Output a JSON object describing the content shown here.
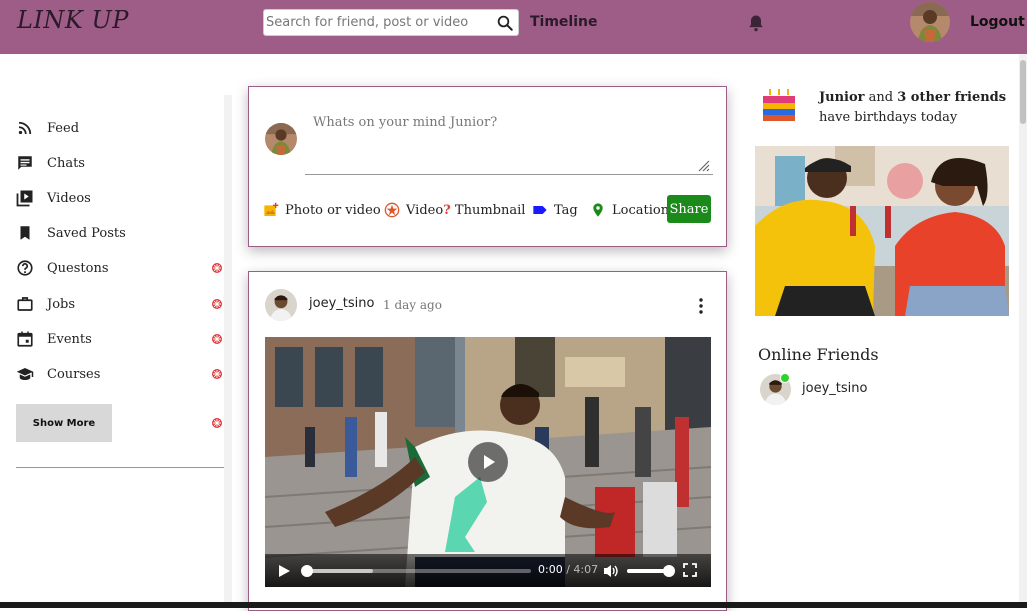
{
  "brand": {
    "logo": "LINK UP"
  },
  "header": {
    "search_placeholder": "Search for friend, post or video",
    "timeline_label": "Timeline",
    "logout_label": "Logout"
  },
  "sidebar": {
    "items": [
      {
        "label": "Feed",
        "icon": "rss-icon",
        "badge": false
      },
      {
        "label": "Chats",
        "icon": "chat-icon",
        "badge": false
      },
      {
        "label": "Videos",
        "icon": "video-library-icon",
        "badge": false
      },
      {
        "label": "Saved Posts",
        "icon": "bookmark-icon",
        "badge": false
      },
      {
        "label": "Questons",
        "icon": "help-circle-icon",
        "badge": true
      },
      {
        "label": "Jobs",
        "icon": "briefcase-icon",
        "badge": true
      },
      {
        "label": "Events",
        "icon": "calendar-icon",
        "badge": true
      },
      {
        "label": "Courses",
        "icon": "graduation-cap-icon",
        "badge": true
      }
    ],
    "show_more_label": "Show More"
  },
  "composer": {
    "placeholder": "Whats on your mind Junior?",
    "options": {
      "photo": "Photo or video",
      "video_thumb": "Video",
      "video_thumb_mark": "?",
      "video_thumb_rest": " Thumbnail",
      "tag": "Tag",
      "location": "Location"
    },
    "share_label": "Share"
  },
  "post": {
    "username": "joey_tsino",
    "time": "1 day ago",
    "video": {
      "current_time": "0:00",
      "separator": " / ",
      "duration": "4:07",
      "progress": 0,
      "buffered": 0.3,
      "volume": 1
    }
  },
  "rightbar": {
    "birthday": {
      "name": "Junior",
      "and_text": " and ",
      "others": "3 other friends",
      "line2": "have birthdays today"
    },
    "online_title": "Online Friends",
    "online_friends": [
      {
        "name": "joey_tsino"
      }
    ]
  },
  "colors": {
    "brand_purple": "#9e5d86",
    "share_green": "#1b8a1b",
    "badge_red": "#e03c3c",
    "online_green": "#2fd12f"
  }
}
